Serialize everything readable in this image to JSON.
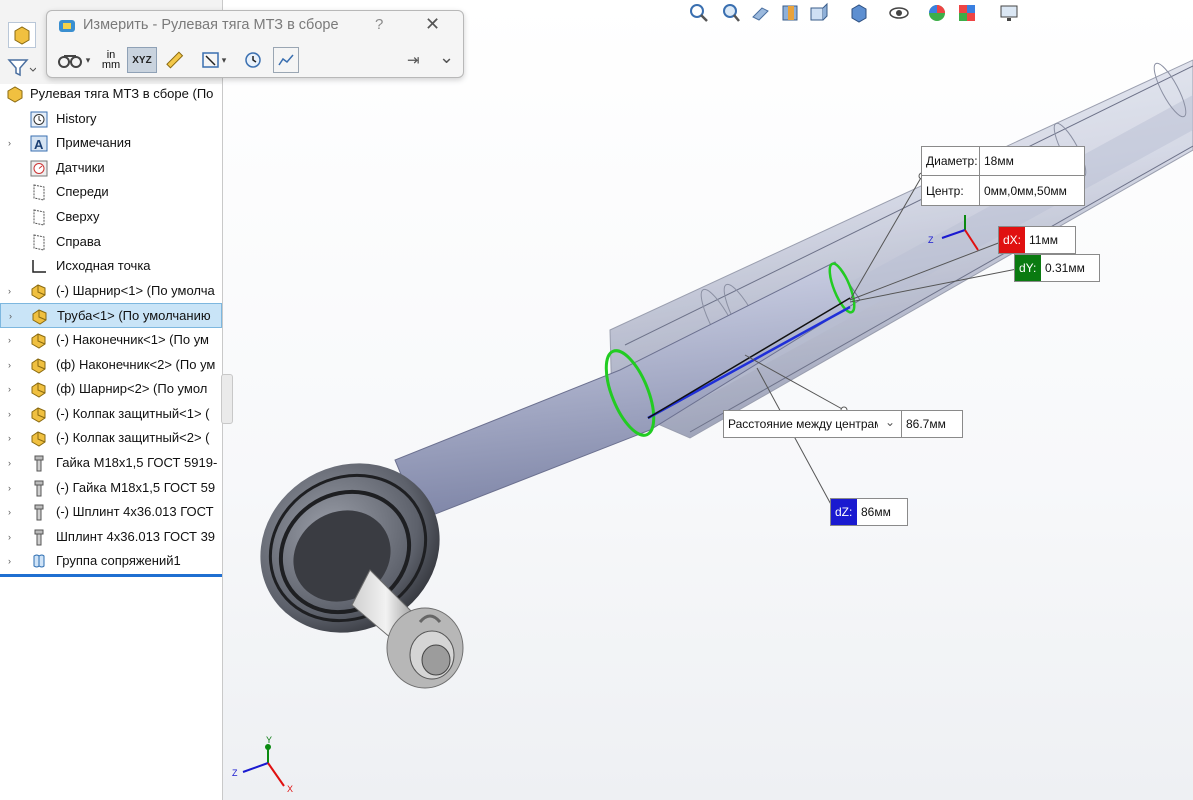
{
  "dialog": {
    "title": "Измерить - Рулевая тяга МТЗ в сборе",
    "help": "?",
    "close": "✕",
    "units_in": "in",
    "units_mm": "mm",
    "xyz_label": "XYZ",
    "pin": "⇥",
    "expand": "⌄"
  },
  "tree": {
    "root": "Рулевая тяга МТЗ в сборе  (По",
    "items": [
      {
        "label": "History",
        "icon": "history-icon",
        "arrow": ""
      },
      {
        "label": "Примечания",
        "icon": "annotations-icon",
        "arrow": "›"
      },
      {
        "label": "Датчики",
        "icon": "sensors-icon",
        "arrow": ""
      },
      {
        "label": "Спереди",
        "icon": "plane-icon",
        "arrow": ""
      },
      {
        "label": "Сверху",
        "icon": "plane-icon",
        "arrow": ""
      },
      {
        "label": "Справа",
        "icon": "plane-icon",
        "arrow": ""
      },
      {
        "label": "Исходная точка",
        "icon": "origin-icon",
        "arrow": ""
      },
      {
        "label": "(-) Шарнир<1> (По умолча",
        "icon": "part-icon",
        "arrow": "›"
      },
      {
        "label": "Труба<1> (По умолчанию",
        "icon": "part-icon",
        "arrow": "›"
      },
      {
        "label": "(-) Наконечник<1> (По ум",
        "icon": "part-icon",
        "arrow": "›"
      },
      {
        "label": "(ф) Наконечник<2> (По ум",
        "icon": "part-icon",
        "arrow": "›"
      },
      {
        "label": "(ф) Шарнир<2> (По умол",
        "icon": "part-icon",
        "arrow": "›"
      },
      {
        "label": "(-) Колпак защитный<1> (",
        "icon": "part-icon",
        "arrow": "›"
      },
      {
        "label": "(-) Колпак защитный<2> (",
        "icon": "part-icon",
        "arrow": "›"
      },
      {
        "label": "Гайка М18х1,5 ГОСТ 5919-",
        "icon": "bolt-icon",
        "arrow": "›"
      },
      {
        "label": "(-) Гайка М18х1,5 ГОСТ 59",
        "icon": "bolt-icon",
        "arrow": "›"
      },
      {
        "label": "(-) Шплинт 4х36.013 ГОСТ",
        "icon": "bolt-icon",
        "arrow": "›"
      },
      {
        "label": "Шплинт 4х36.013 ГОСТ 39",
        "icon": "bolt-icon",
        "arrow": "›"
      },
      {
        "label": "Группа сопряжений1",
        "icon": "mates-icon",
        "arrow": "›"
      }
    ],
    "selected_index": 8
  },
  "measure": {
    "diameter_label": "Диаметр:",
    "diameter_value": "18мм",
    "center_label": "Центр:",
    "center_value": "0мм,0мм,50мм",
    "dx_label": "dX:",
    "dx_value": "11мм",
    "dy_label": "dY:",
    "dy_value": "0.31мм",
    "dz_label": "dZ:",
    "dz_value": "86мм",
    "distance_select": "Расстояние между центрам",
    "distance_value": "86.7мм"
  },
  "axes": {
    "x": "X",
    "y": "Y",
    "z": "Z"
  },
  "colors": {
    "dx": "#e01010",
    "dy": "#0a7a10",
    "dz": "#1a1ad0",
    "selection": "#c9e4f7",
    "highlight_green": "#22cc22",
    "measure_line": "#1f2fd8"
  }
}
